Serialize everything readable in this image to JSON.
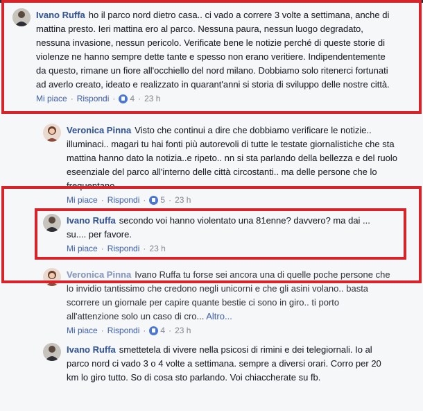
{
  "comments": [
    {
      "author": "Ivano Ruffa",
      "text": "ho il parco nord dietro casa.. ci vado a correre 3 volte a settimana, anche di mattina presto. Ieri mattina ero al parco. Nessuna paura, nessun luogo degradato, nessuna invasione, nessun pericolo. Verificate bene le notizie perché di queste storie di violenze ne hanno sempre dette tante e spesso non erano veritiere. Indipendentemente da questo, rimane un fiore all'occhiello del nord milano. Dobbiamo solo ritenerci fortunati ad averlo creato, ideato e realizzato in quarant'anni si storia di sviluppo delle nostre città.",
      "like": "Mi piace",
      "reply": "Rispondi",
      "likes": "4",
      "time": "23 h"
    },
    {
      "author": "Veronica Pinna",
      "text": "Visto che continui a dire che dobbiamo verificare le notizie.. illuminaci.. magari tu hai fonti più autorevoli di tutte le testate giornalistiche che sta mattina hanno dato la notizia..e ripeto.. nn si sta parlando della bellezza e del ruolo eseenziale del parco all'interno delle città circostanti.. ma delle persone che lo frequentano",
      "like": "Mi piace",
      "reply": "Rispondi",
      "likes": "5",
      "time": "23 h"
    },
    {
      "author": "Ivano Ruffa",
      "text": "secondo voi hanno violentato una 81enne? davvero? ma dai ... su.... per favore.",
      "like": "Mi piace",
      "reply": "Rispondi",
      "time": "23 h"
    },
    {
      "author": "Veronica Pinna",
      "text": "Ivano Ruffa tu forse sei ancora una di quelle poche persone che lo invidio tantissimo che credono negli unicorni e che gli asini volano.. basta scorrere un giornale per capire quante bestie ci sono in giro.. ti porto all'attenzione solo un caso di cro...",
      "more": "Altro...",
      "like": "Mi piace",
      "reply": "Rispondi",
      "likes": "4",
      "time": "23 h"
    },
    {
      "author": "Ivano Ruffa",
      "text": "smettetela di vivere nella psicosi di rimini e dei telegiornali. Io al parco nord ci vado 3 o 4 volte a settimana. sempre a diversi orari. Corro per 20 km lo giro tutto. So di cosa sto parlando. Voi chiaccherate su fb.",
      "like": "Mi piace",
      "reply": "Rispondi"
    }
  ]
}
